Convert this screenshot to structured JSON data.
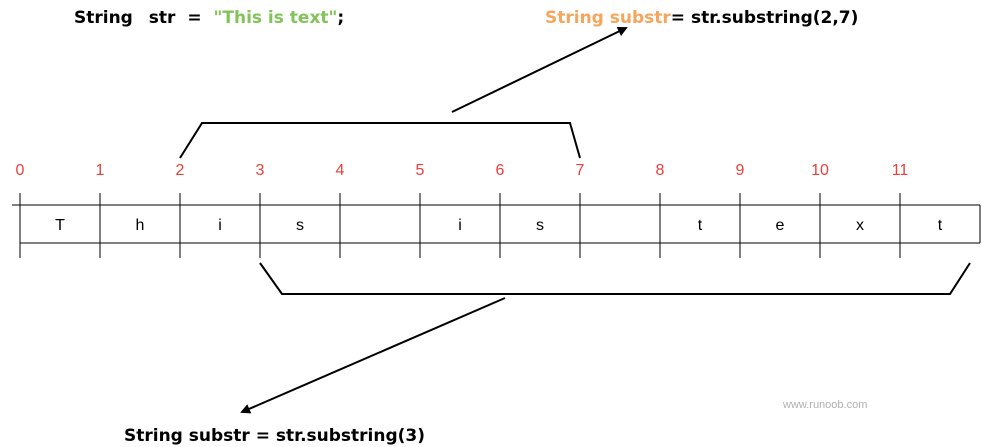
{
  "top_statement": {
    "type": "String",
    "var": "str",
    "eq": "=",
    "literal": "\"This is text\"",
    "semicolon": ";"
  },
  "substr_2_7": {
    "decl": "String substr",
    "rest": "= str.substring(2,7)"
  },
  "substr_3": {
    "text": "String substr = str.substring(3)"
  },
  "indices": [
    "0",
    "1",
    "2",
    "3",
    "4",
    "5",
    "6",
    "7",
    "8",
    "9",
    "10",
    "11"
  ],
  "chars": [
    "T",
    "h",
    "i",
    "s",
    "",
    "i",
    "s",
    "",
    "t",
    "e",
    "x",
    "t"
  ],
  "watermark": "www.runoob.com",
  "colors": {
    "index": "#e8403d",
    "literal": "#82c35a",
    "highlight": "#f6a55d",
    "line": "#000000"
  }
}
